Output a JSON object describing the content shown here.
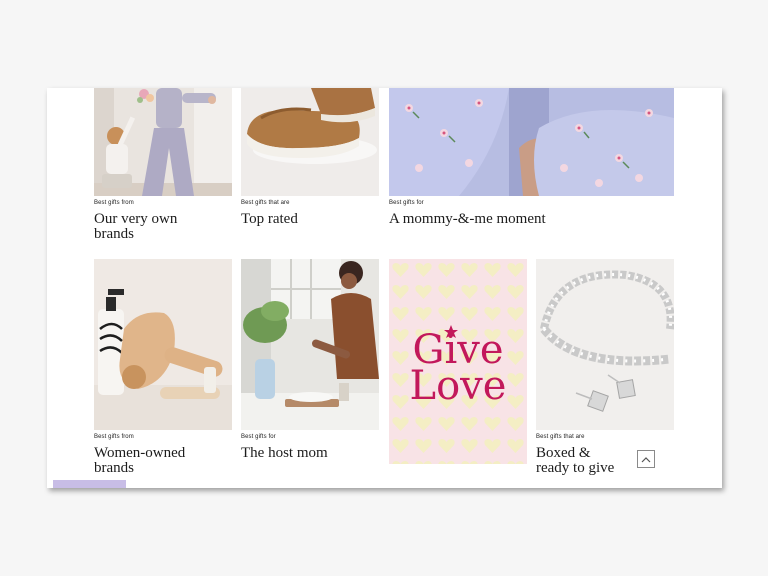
{
  "grid": {
    "row1": [
      {
        "kicker": "Best gifts from",
        "title_line1": "Our very own",
        "title_line2": "brands",
        "image": "woman-and-child-image"
      },
      {
        "kicker": "Best gifts that are",
        "title_line1": "Top rated",
        "title_line2": "",
        "image": "clog-slippers-image"
      },
      {
        "kicker": "Best gifts for",
        "title_line1": "A mommy-&-me moment",
        "title_line2": "",
        "image": "floral-dresses-image"
      }
    ],
    "row2": [
      {
        "kicker": "Best gifts from",
        "title_line1": "Women-owned",
        "title_line2": "brands",
        "image": "hair-dryer-products-image"
      },
      {
        "kicker": "Best gifts for",
        "title_line1": "The host mom",
        "title_line2": "",
        "image": "woman-setting-table-image"
      },
      {
        "kicker": "",
        "title_line1": "",
        "title_line2": "",
        "image": "give-love-graphic",
        "graphic_text_line1": "Give",
        "graphic_text_line2": "Love"
      },
      {
        "kicker": "Best gifts that are",
        "title_line1": "Boxed &",
        "title_line2": "ready to give",
        "image": "tennis-bracelet-image"
      }
    ]
  },
  "icons": {
    "scroll_top": "chevron-up-icon"
  },
  "scroll_progress": 0.12,
  "colors": {
    "accent": "#c8bde6",
    "give_love": "#c2185b",
    "background": "#f6f6f6"
  }
}
